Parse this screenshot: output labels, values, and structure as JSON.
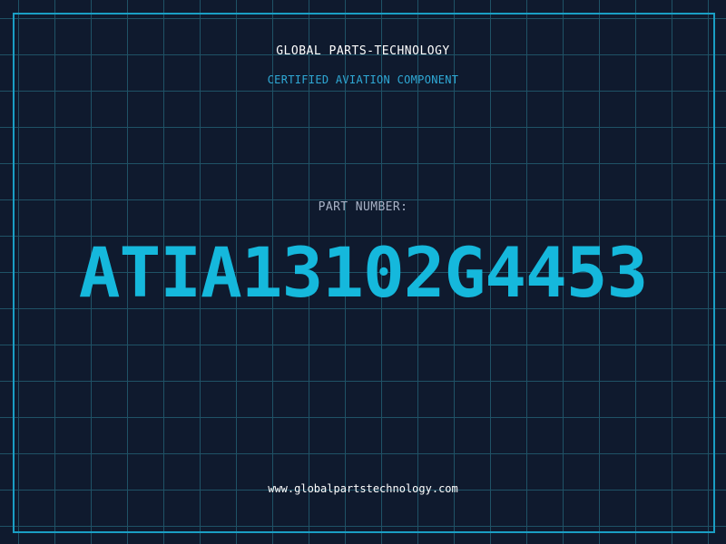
{
  "header": {
    "brand": "GLOBAL PARTS-TECHNOLOGY",
    "tagline": "CERTIFIED AVIATION COMPONENT"
  },
  "part": {
    "label": "PART NUMBER:",
    "number": "ATIA13102G4453"
  },
  "footer": {
    "website": "www.globalpartstechnology.com"
  },
  "colors": {
    "background": "#0f1a2e",
    "grid": "#1f5266",
    "frame": "#1a9ec4",
    "accent": "#15b8dc",
    "tagline": "#2fa9d6",
    "label": "#a8b2c6",
    "text": "#ffffff"
  }
}
